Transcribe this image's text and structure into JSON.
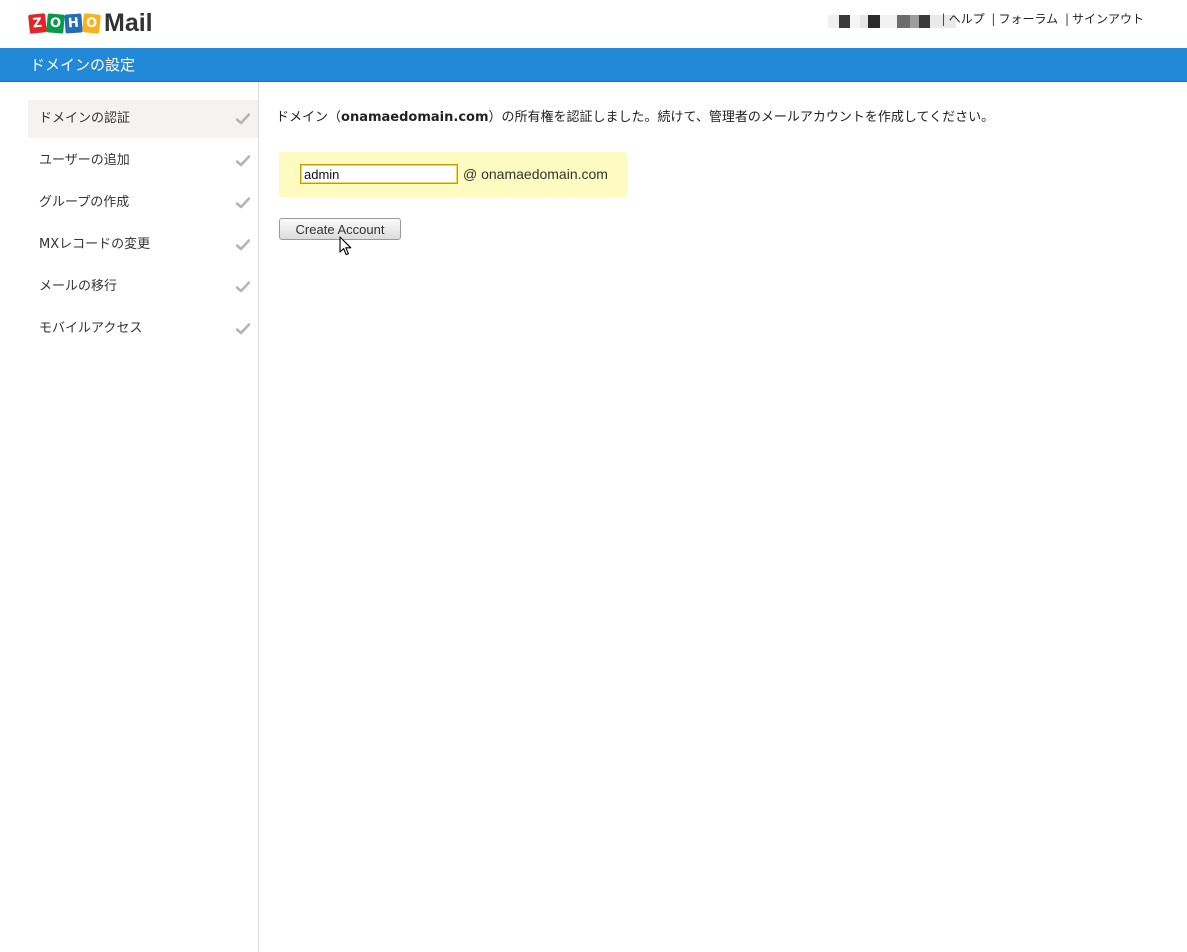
{
  "header": {
    "logo_letters": [
      "Z",
      "O",
      "H",
      "O"
    ],
    "logo_colors": [
      "#e42527",
      "#089949",
      "#226db4",
      "#f9b21d"
    ],
    "logo_text": "Mail",
    "user_blur_colors": [
      "#f0f0f0",
      "#3a3a3a",
      "#f5f5f5",
      "#e6e6e6",
      "#2c2c2c",
      "#f2f2f2",
      "#6d6d6d",
      "#9e9e9e",
      "#3a3a3a",
      "#e9e9e9"
    ],
    "links": [
      {
        "label": "ヘルプ"
      },
      {
        "label": "フォーラム"
      },
      {
        "label": "サインアウト"
      }
    ]
  },
  "titlebar": {
    "title": "ドメインの設定",
    "color": "#2189d8"
  },
  "sidebar": {
    "items": [
      {
        "label": "ドメインの認証",
        "checked": true,
        "active": true
      },
      {
        "label": "ユーザーの追加",
        "checked": true,
        "active": false
      },
      {
        "label": "グループの作成",
        "checked": true,
        "active": false
      },
      {
        "label": "MXレコードの変更",
        "checked": true,
        "active": false
      },
      {
        "label": "メールの移行",
        "checked": true,
        "active": false
      },
      {
        "label": "モバイルアクセス",
        "checked": true,
        "active": false
      }
    ]
  },
  "main": {
    "message_prefix": "ドメイン（",
    "message_domain": "onamaedomain.com",
    "message_suffix": "）の所有権を認証しました。続けて、管理者のメールアカウントを作成してください。",
    "form": {
      "username_value": "admin",
      "domain_suffix": "@ onamaedomain.com",
      "box_color": "#fefbc0"
    },
    "create_button_label": "Create Account"
  }
}
